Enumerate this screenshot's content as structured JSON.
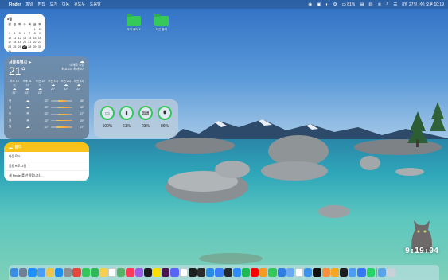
{
  "menubar": {
    "apple_icon": "",
    "app_name": "Finder",
    "menus": [
      "파일",
      "편집",
      "보기",
      "이동",
      "윈도우",
      "도움말"
    ],
    "battery_text": "81%",
    "datetime": "8월 27일 (수) 오후 10:19"
  },
  "calendar": {
    "month": "8월",
    "weekdays": [
      "일",
      "월",
      "화",
      "수",
      "목",
      "금",
      "토"
    ],
    "today": 27
  },
  "weather": {
    "city": "서울특별시",
    "temp": "21°",
    "condition": "대체로 흐림",
    "range": "최고:23° 최저:20°",
    "hourly": [
      {
        "time": "오후 10시",
        "temp": "21°"
      },
      {
        "time": "오후 11시",
        "temp": "22°"
      },
      {
        "time": "오전 12시",
        "temp": "23°"
      },
      {
        "time": "오전 1시",
        "temp": "22°"
      },
      {
        "time": "오전 2시",
        "temp": "22°"
      },
      {
        "time": "오전 3시",
        "temp": "22°"
      }
    ],
    "daily": [
      {
        "day": "목",
        "lo": "23°",
        "hi": "26°",
        "fill_from": 0.35,
        "fill_to": 0.75
      },
      {
        "day": "금",
        "lo": "23°",
        "hi": "28°",
        "fill_from": 0.35,
        "fill_to": 0.9
      },
      {
        "day": "토",
        "lo": "23°",
        "hi": "27°",
        "fill_from": 0.35,
        "fill_to": 0.85
      },
      {
        "day": "일",
        "lo": "22°",
        "hi": "29°",
        "fill_from": 0.25,
        "fill_to": 0.95
      },
      {
        "day": "월",
        "lo": "22°",
        "hi": "27°",
        "fill_from": 0.25,
        "fill_to": 0.85
      }
    ]
  },
  "battery_widget": {
    "items": [
      {
        "icon": "laptop-icon",
        "glyph": "▭",
        "pct": "100%"
      },
      {
        "icon": "phone-icon",
        "glyph": "▮",
        "pct": "61%"
      },
      {
        "icon": "keyboard-icon",
        "glyph": "⌨",
        "pct": "23%"
      },
      {
        "icon": "mouse-icon",
        "glyph": "⬮",
        "pct": "86%"
      }
    ]
  },
  "reminders": {
    "title": "폴더",
    "items": [
      "다운로드",
      "응용프로그램",
      "새 Finder를 선택합니다..."
    ]
  },
  "desktop": {
    "folders": [
      {
        "label": "자세 폴더 2"
      },
      {
        "label": "다운 폴더"
      }
    ]
  },
  "clock": {
    "time": "9:19:04"
  },
  "dock": {
    "apps": [
      {
        "name": "finder-icon",
        "color": "#3a8ee6"
      },
      {
        "name": "launchpad-icon",
        "color": "#6f7f94"
      },
      {
        "name": "safari-icon",
        "color": "#1e90ff"
      },
      {
        "name": "mail-icon",
        "color": "#4a9ef5"
      },
      {
        "name": "photos-icon",
        "color": "#f0c34d"
      },
      {
        "name": "app-store-icon",
        "color": "#1f8ef1"
      },
      {
        "name": "settings-icon",
        "color": "#8e8e93"
      },
      {
        "name": "chrome-icon",
        "color": "#e8473c"
      },
      {
        "name": "messages-icon",
        "color": "#34c759"
      },
      {
        "name": "facetime-icon",
        "color": "#2fb85a"
      },
      {
        "name": "notes-icon",
        "color": "#f6d04d"
      },
      {
        "name": "calendar-icon",
        "color": "#ffffff"
      },
      {
        "name": "maps-icon",
        "color": "#58b368"
      },
      {
        "name": "music-icon",
        "color": "#fa3c5a"
      },
      {
        "name": "podcasts-icon",
        "color": "#9b5de5"
      },
      {
        "name": "tv-icon",
        "color": "#1c1c1e"
      },
      {
        "name": "kakaotalk-icon",
        "color": "#f9e000"
      },
      {
        "name": "slack-icon",
        "color": "#4a154b"
      },
      {
        "name": "discord-icon",
        "color": "#5865f2"
      },
      {
        "name": "notion-icon",
        "color": "#ffffff"
      },
      {
        "name": "figma-icon",
        "color": "#1e1e1e"
      },
      {
        "name": "terminal-icon",
        "color": "#2b2b2b"
      },
      {
        "name": "vscode-icon",
        "color": "#2a8be2"
      },
      {
        "name": "xcode-icon",
        "color": "#3a7ef6"
      },
      {
        "name": "github-icon",
        "color": "#24292f"
      },
      {
        "name": "zoom-icon",
        "color": "#2d8cff"
      },
      {
        "name": "spotify-icon",
        "color": "#1db954"
      },
      {
        "name": "youtube-icon",
        "color": "#ff0000"
      },
      {
        "name": "pages-icon",
        "color": "#f59a23"
      },
      {
        "name": "numbers-icon",
        "color": "#34c759"
      },
      {
        "name": "keynote-icon",
        "color": "#2f7de1"
      },
      {
        "name": "preview-icon",
        "color": "#6aa8f0"
      },
      {
        "name": "reminders-icon",
        "color": "#ffffff"
      },
      {
        "name": "weather-icon",
        "color": "#3c92e8"
      },
      {
        "name": "stocks-icon",
        "color": "#111111"
      },
      {
        "name": "books-icon",
        "color": "#f7913d"
      },
      {
        "name": "home-icon",
        "color": "#f5a623"
      },
      {
        "name": "clock-icon",
        "color": "#1c1c1e"
      },
      {
        "name": "files-icon",
        "color": "#4d9df0"
      },
      {
        "name": "translate-icon",
        "color": "#3478f6"
      },
      {
        "name": "whatsapp-icon",
        "color": "#25d366"
      }
    ],
    "trailing": [
      {
        "name": "downloads-stack-icon",
        "color": "#5ba3e8"
      },
      {
        "name": "trash-icon",
        "color": "#c8d0d8"
      }
    ]
  }
}
